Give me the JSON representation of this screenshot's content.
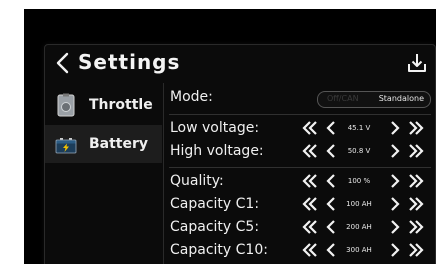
{
  "header": {
    "back_icon": "chevron-left-icon",
    "title": "Settings",
    "save_icon": "download-tray-icon"
  },
  "sidebar": {
    "items": [
      {
        "label": "Throttle",
        "icon": "throttle-device-icon",
        "active": false
      },
      {
        "label": "Battery",
        "icon": "battery-icon",
        "active": true
      }
    ]
  },
  "settings": {
    "mode": {
      "label": "Mode:",
      "off_text": "Off/CAN",
      "selected": "Standalone"
    },
    "low_voltage": {
      "label": "Low voltage:",
      "value": "45.1 V"
    },
    "high_voltage": {
      "label": "High voltage:",
      "value": "50.8 V"
    },
    "quality": {
      "label": "Quality:",
      "value": "100 %"
    },
    "capacity_c1": {
      "label": "Capacity C1:",
      "value": "100 AH"
    },
    "capacity_c5": {
      "label": "Capacity C5:",
      "value": "200 AH"
    },
    "capacity_c10": {
      "label": "Capacity C10:",
      "value": "300 AH"
    }
  },
  "colors": {
    "background": "#000000",
    "text": "#f0f0f0",
    "battery_accent": "#f2c200"
  }
}
